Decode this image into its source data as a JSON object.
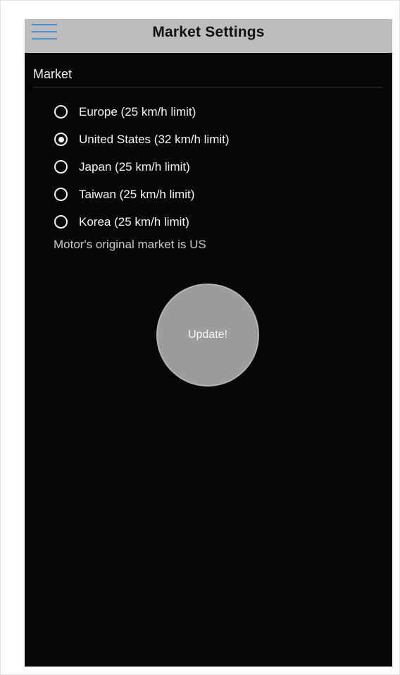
{
  "header": {
    "title": "Market Settings",
    "menu_icon": "hamburger-menu-icon"
  },
  "market": {
    "label": "Market",
    "options": [
      {
        "label": "Europe (25 km/h limit)",
        "selected": false
      },
      {
        "label": "United States (32 km/h limit)",
        "selected": true
      },
      {
        "label": "Japan (25 km/h limit)",
        "selected": false
      },
      {
        "label": "Taiwan (25 km/h limit)",
        "selected": false
      },
      {
        "label": "Korea (25 km/h limit)",
        "selected": false
      }
    ],
    "original_note": "Motor's original market is US"
  },
  "update_button": {
    "label": "Update!"
  },
  "colors": {
    "header_bg": "#bdbdbd",
    "screen_bg": "#070707",
    "menu_icon": "#4a90d9",
    "button_bg": "#9c9c9c"
  }
}
